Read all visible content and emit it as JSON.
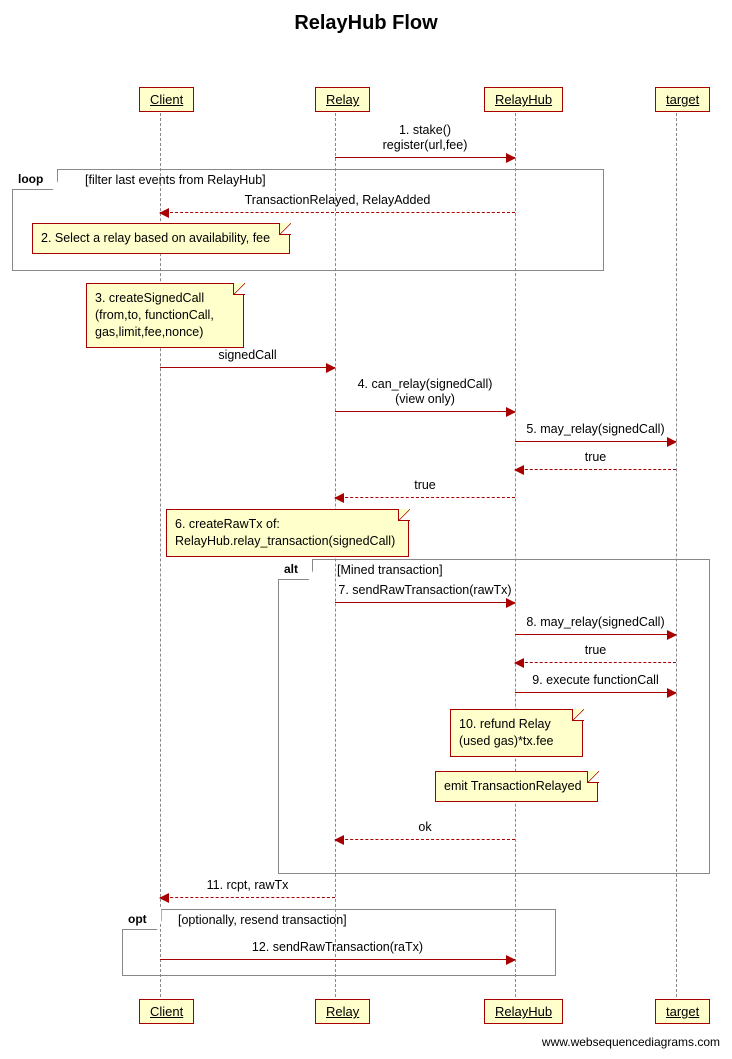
{
  "title": "RelayHub Flow",
  "actors": {
    "client": "Client",
    "relay": "Relay",
    "relayhub": "RelayHub",
    "target": "target"
  },
  "messages": {
    "m1": "1. stake()\nregister(url,fee)",
    "loop_cond": "[filter last events from RelayHub]",
    "loop_msg": "TransactionRelayed, RelayAdded",
    "note2": "2. Select a relay based on availability, fee",
    "note3": "3. createSignedCall\n(from,to, functionCall,\ngas,limit,fee,nonce)",
    "m_signed": "signedCall",
    "m4": "4. can_relay(signedCall)\n(view only)",
    "m5": "5. may_relay(signedCall)",
    "m5r": "true",
    "m_true2": "true",
    "note6": "6. createRawTx of:\nRelayHub.relay_transaction(signedCall)",
    "alt_cond": "[Mined transaction]",
    "m7": "7. sendRawTransaction(rawTx)",
    "m8": "8. may_relay(signedCall)",
    "m8r": "true",
    "m9": "9. execute functionCall",
    "note10": "10. refund Relay\n(used gas)*tx.fee",
    "note_emit": "emit TransactionRelayed",
    "m_ok": "ok",
    "m11": "11. rcpt, rawTx",
    "opt_cond": "[optionally, resend transaction]",
    "m12": "12. sendRawTransaction(raTx)"
  },
  "frame_labels": {
    "loop": "loop",
    "alt": "alt",
    "opt": "opt"
  },
  "credit": "www.websequencediagrams.com"
}
